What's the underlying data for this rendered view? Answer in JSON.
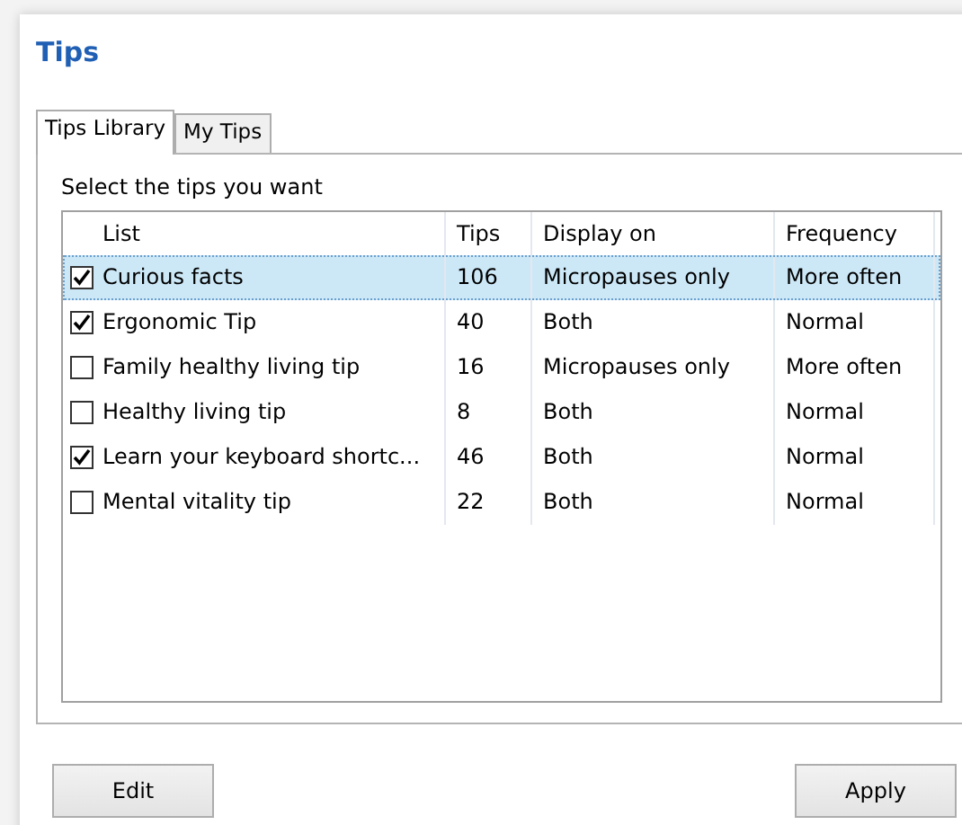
{
  "title": "Tips",
  "tabs": [
    {
      "label": "Tips Library",
      "selected": true
    },
    {
      "label": "My Tips",
      "selected": false
    }
  ],
  "instruction": "Select the tips you want",
  "table": {
    "columns": [
      "List",
      "Tips",
      "Display on",
      "Frequency"
    ],
    "rows": [
      {
        "name": "Curious facts",
        "tips": "106",
        "display_on": "Micropauses only",
        "frequency": "More often",
        "checked": true,
        "selected": true
      },
      {
        "name": "Ergonomic Tip",
        "tips": "40",
        "display_on": "Both",
        "frequency": "Normal",
        "checked": true,
        "selected": false
      },
      {
        "name": "Family healthy living tip",
        "tips": "16",
        "display_on": "Micropauses only",
        "frequency": "More often",
        "checked": false,
        "selected": false
      },
      {
        "name": "Healthy living tip",
        "tips": "8",
        "display_on": "Both",
        "frequency": "Normal",
        "checked": false,
        "selected": false
      },
      {
        "name": "Learn your keyboard shortc...",
        "tips": "46",
        "display_on": "Both",
        "frequency": "Normal",
        "checked": true,
        "selected": false
      },
      {
        "name": "Mental vitality tip",
        "tips": "22",
        "display_on": "Both",
        "frequency": "Normal",
        "checked": false,
        "selected": false
      }
    ]
  },
  "buttons": {
    "left": "Edit",
    "right": "Apply"
  }
}
